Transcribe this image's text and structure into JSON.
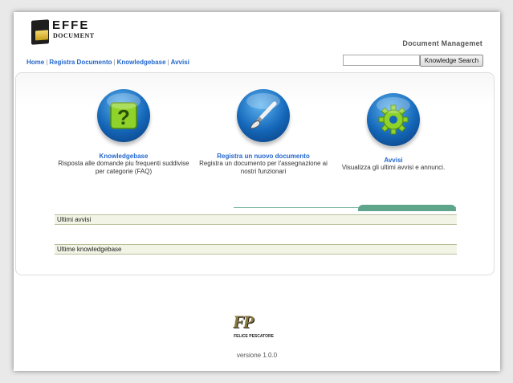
{
  "logo": {
    "title": "EFFE",
    "subtitle": "DOCUMENT"
  },
  "app_title": "Document Managemet",
  "nav": {
    "items": [
      {
        "label": "Home"
      },
      {
        "label": "Registra Documento"
      },
      {
        "label": "Knowledgebase"
      },
      {
        "label": "Avvisi"
      }
    ],
    "separator": "|"
  },
  "search": {
    "placeholder": "",
    "value": "",
    "button_label": "Knowledge Search"
  },
  "features": [
    {
      "icon": "help-question-icon",
      "title": "Knowledgebase",
      "description": "Risposta alle domande piu frequenti suddivise per categorie (FAQ)"
    },
    {
      "icon": "paintbrush-icon",
      "title": "Registra un nuovo documento",
      "description": "Registra un documento per l'assegnazione ai nostri funzionari"
    },
    {
      "icon": "gear-icon",
      "title": "Avvisi",
      "description": "Visualizza gli ultimi avvisi e annunci."
    }
  ],
  "sections": [
    {
      "title": "Ultimi avvisi"
    },
    {
      "title": "Ultime knowledgebase"
    }
  ],
  "footer": {
    "logo_mark": "FP",
    "logo_name": "FELICE PESCATORE",
    "version": "versione 1.0.0"
  },
  "colors": {
    "link": "#2266cc",
    "orb": "#1466b8",
    "tab": "#5fa58b",
    "section_bg": "#f2f5e6"
  }
}
